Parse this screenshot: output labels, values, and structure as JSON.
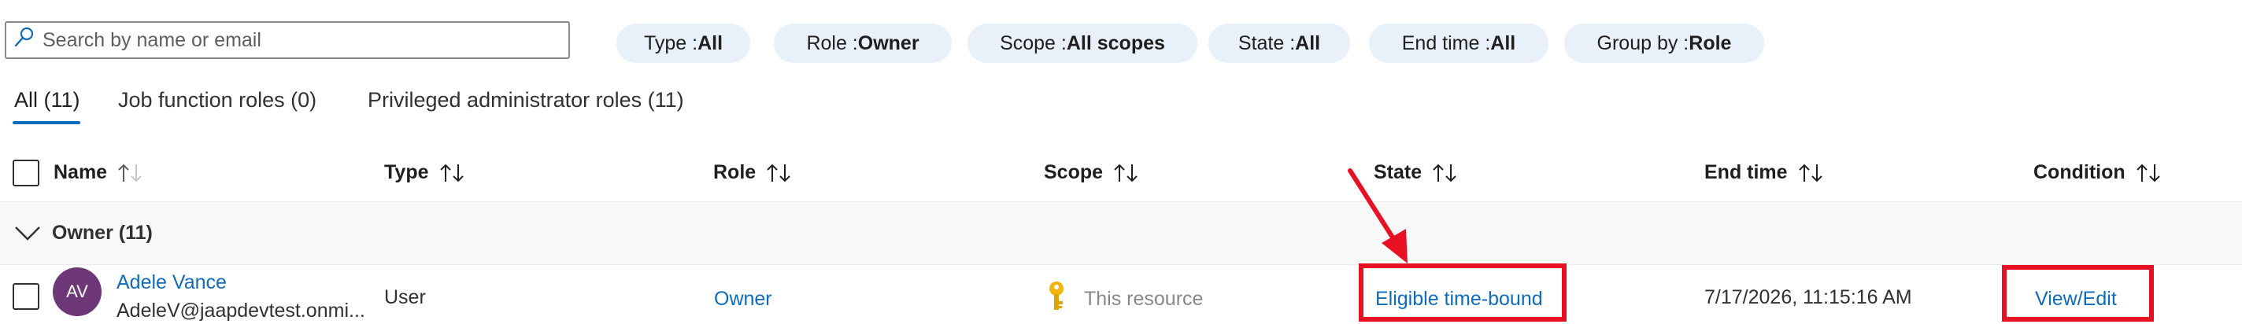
{
  "search": {
    "placeholder": "Search by name or email"
  },
  "filters": [
    {
      "label": "Type : ",
      "value": "All"
    },
    {
      "label": "Role : ",
      "value": "Owner"
    },
    {
      "label": "Scope : ",
      "value": "All scopes"
    },
    {
      "label": "State : ",
      "value": "All"
    },
    {
      "label": "End time : ",
      "value": "All"
    },
    {
      "label": "Group by : ",
      "value": "Role"
    }
  ],
  "tabs": [
    {
      "label": "All (11)"
    },
    {
      "label": "Job function roles (0)"
    },
    {
      "label": "Privileged administrator roles (11)"
    }
  ],
  "columns": {
    "name": "Name",
    "type": "Type",
    "role": "Role",
    "scope": "Scope",
    "state": "State",
    "end_time": "End time",
    "condition": "Condition"
  },
  "group": {
    "label": "Owner (11)"
  },
  "row": {
    "avatar_initials": "AV",
    "name": "Adele Vance",
    "email": "AdeleV@jaapdevtest.onmi...",
    "type": "User",
    "role": "Owner",
    "scope": "This resource",
    "state": "Eligible time-bound",
    "end_time": "7/17/2026, 11:15:16 AM",
    "condition": "View/Edit"
  },
  "colors": {
    "accent": "#0f6cbd",
    "pill_bg": "#e8f0f9",
    "highlight": "#e81123",
    "avatar_bg": "#6d3778",
    "key_icon": "#f2b50c"
  },
  "icons": {
    "search": "search-icon",
    "sort": "sort-arrows-icon",
    "group_toggle": "chevron-down-icon",
    "scope": "key-icon"
  }
}
